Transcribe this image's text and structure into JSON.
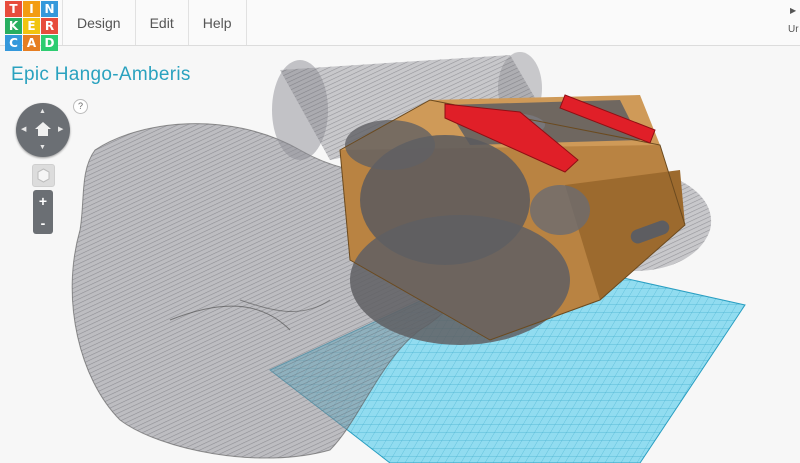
{
  "app": {
    "logo_letters": [
      "T",
      "I",
      "N",
      "K",
      "E",
      "R",
      "C",
      "A",
      "D"
    ],
    "logo_colors": [
      "#e74c3c",
      "#f39c12",
      "#3498db",
      "#27ae60",
      "#f1c40f",
      "#e74c3c",
      "#3498db",
      "#e67e22",
      "#2ecc71"
    ]
  },
  "menu": {
    "design": "Design",
    "edit": "Edit",
    "help": "Help"
  },
  "top_right": {
    "icon": "triangle-right-icon",
    "text": "Ur"
  },
  "project": {
    "title": "Epic Hango-Amberis",
    "help_glyph": "?"
  },
  "controls": {
    "zoom_in": "+",
    "zoom_out": "-"
  },
  "colors": {
    "accent": "#2aa2bf",
    "workplane": "#4fc3e3",
    "ghost_shape": "#8c8c92",
    "body_shape": "#b98342",
    "red_part": "#e01f28"
  }
}
